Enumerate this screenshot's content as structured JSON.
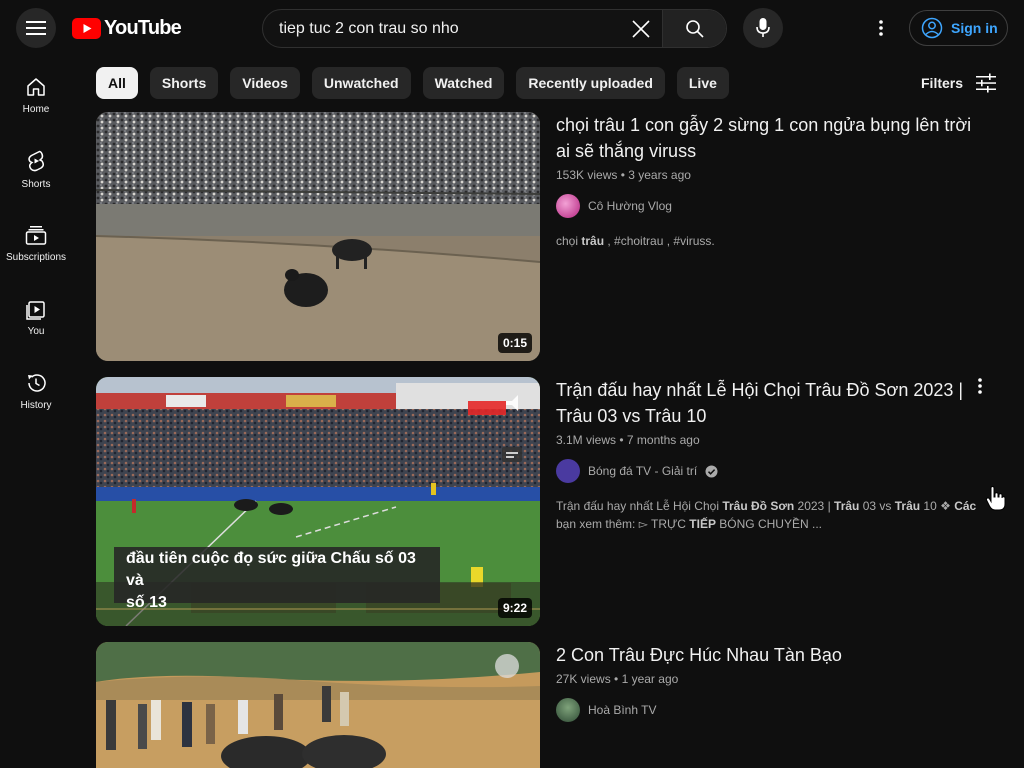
{
  "header": {
    "logo_text": "YouTube",
    "search_value": "tiep tuc 2 con trau so nho",
    "signin_label": "Sign in"
  },
  "sidebar": {
    "items": [
      {
        "label": "Home",
        "icon": "home-icon"
      },
      {
        "label": "Shorts",
        "icon": "shorts-icon"
      },
      {
        "label": "Subscriptions",
        "icon": "subscriptions-icon"
      },
      {
        "label": "You",
        "icon": "you-icon"
      },
      {
        "label": "History",
        "icon": "history-icon"
      }
    ]
  },
  "chips": [
    "All",
    "Shorts",
    "Videos",
    "Unwatched",
    "Watched",
    "Recently uploaded",
    "Live"
  ],
  "filters_label": "Filters",
  "videos": [
    {
      "title": "chọi trâu 1 con gẫy 2 sừng 1 con ngửa bụng lên trời ai sẽ thắng viruss",
      "views": "153K views",
      "age": "3 years ago",
      "channel": "Cô Hường Vlog",
      "description_parts": [
        "chọi ",
        "trâu",
        " , #choitrau , #viruss."
      ],
      "duration": "0:15"
    },
    {
      "title": "Trận đấu hay nhất Lễ Hội Chọi Trâu Đồ Sơn 2023 | Trâu 03 vs Trâu 10",
      "views": "3.1M views",
      "age": "7 months ago",
      "channel": "Bóng đá TV - Giải trí",
      "verified": true,
      "description_parts": [
        "Trận đấu hay nhất Lễ Hội Chọi ",
        "Trâu Đồ Sơn",
        " 2023 | ",
        "Trâu",
        " 03 vs ",
        "Trâu",
        " 10 ❖ ",
        "Các",
        " bạn xem thêm: ▻ TRỰC ",
        "TIẾP",
        " BÓNG CHUYỀN ..."
      ],
      "duration": "9:22",
      "overlay_caption_1": "đầu tiên cuộc đọ sức giữa Chấu số 03 và",
      "overlay_caption_2": "số 13"
    },
    {
      "title": "2 Con Trâu Đực Húc Nhau Tàn Bạo",
      "views": "27K views",
      "age": "1 year ago",
      "channel": "Hoà Bình TV"
    }
  ],
  "colors": {
    "background": "#0f0f0f",
    "accent_red": "#ff0000",
    "link_blue": "#3ea6ff",
    "chip_bg": "#272727"
  }
}
